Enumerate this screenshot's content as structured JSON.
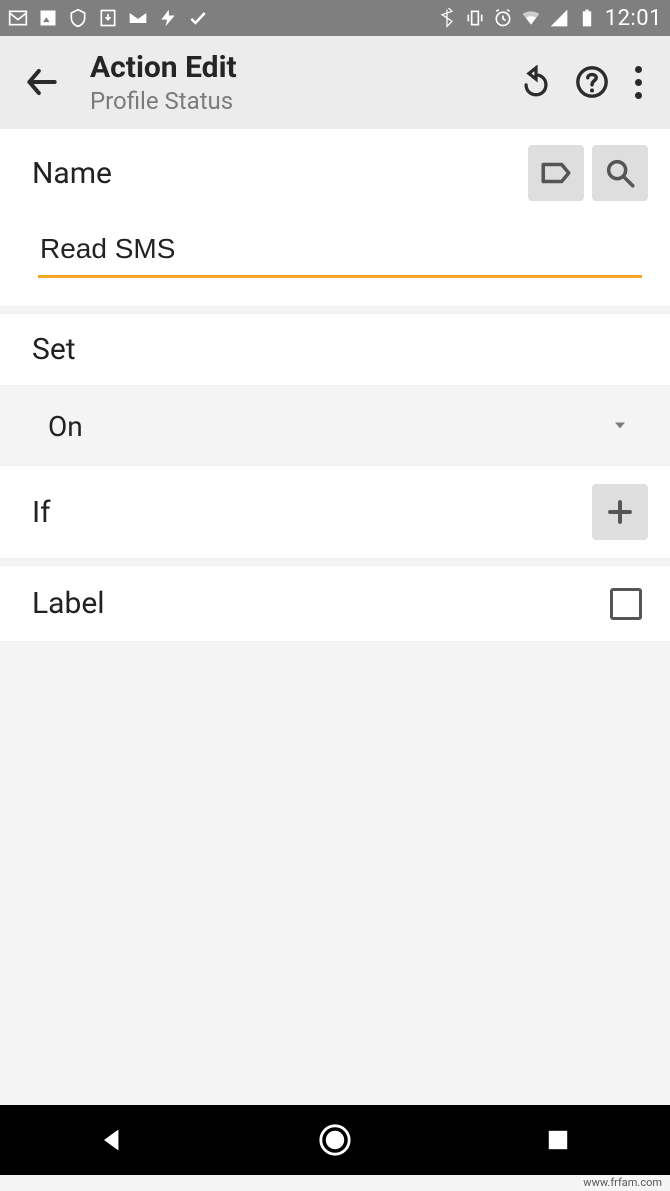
{
  "status_bar": {
    "time": "12:01"
  },
  "app_bar": {
    "title": "Action Edit",
    "subtitle": "Profile Status"
  },
  "sections": {
    "name": {
      "label": "Name",
      "value": "Read SMS"
    },
    "set": {
      "label": "Set",
      "selected": "On"
    },
    "if_cond": {
      "label": "If"
    },
    "label_opt": {
      "label": "Label",
      "checked": false
    }
  },
  "watermark": "www.frfam.com"
}
